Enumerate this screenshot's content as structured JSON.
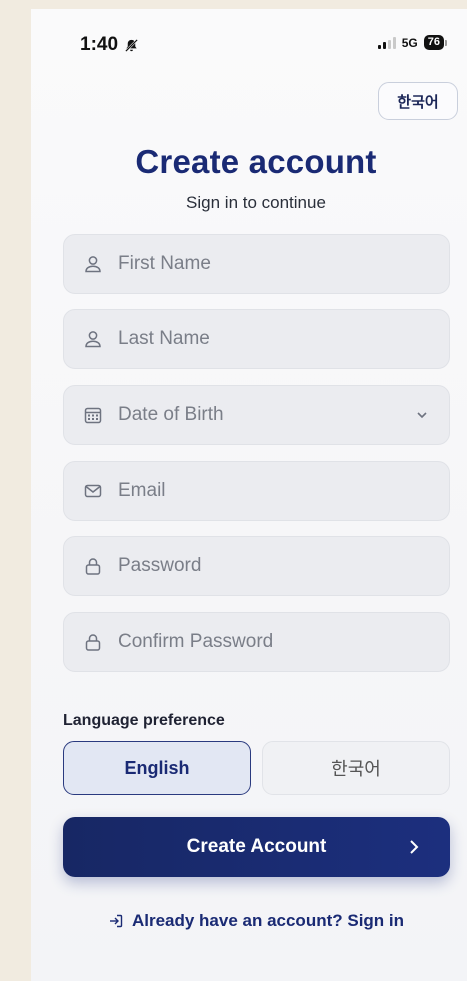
{
  "status_bar": {
    "time": "1:40",
    "network": "5G",
    "battery": "76"
  },
  "header": {
    "language_toggle": "한국어",
    "title": "Create account",
    "subtitle": "Sign in to continue"
  },
  "form": {
    "first_name": {
      "placeholder": "First Name",
      "icon": "user-icon"
    },
    "last_name": {
      "placeholder": "Last Name",
      "icon": "user-icon"
    },
    "date_of_birth": {
      "placeholder": "Date of Birth",
      "icon": "calendar-icon"
    },
    "email": {
      "placeholder": "Email",
      "icon": "mail-icon"
    },
    "password": {
      "placeholder": "Password",
      "icon": "lock-icon"
    },
    "confirm_password": {
      "placeholder": "Confirm Password",
      "icon": "lock-icon"
    }
  },
  "language_preference": {
    "label": "Language preference",
    "options": [
      "English",
      "한국어"
    ],
    "selected": "English"
  },
  "actions": {
    "create_account": "Create Account",
    "sign_in_link": "Already have an account? Sign in"
  },
  "colors": {
    "primary": "#1a2a74",
    "field_bg": "#ebecf0",
    "page_bg": "#f1ebe0"
  }
}
